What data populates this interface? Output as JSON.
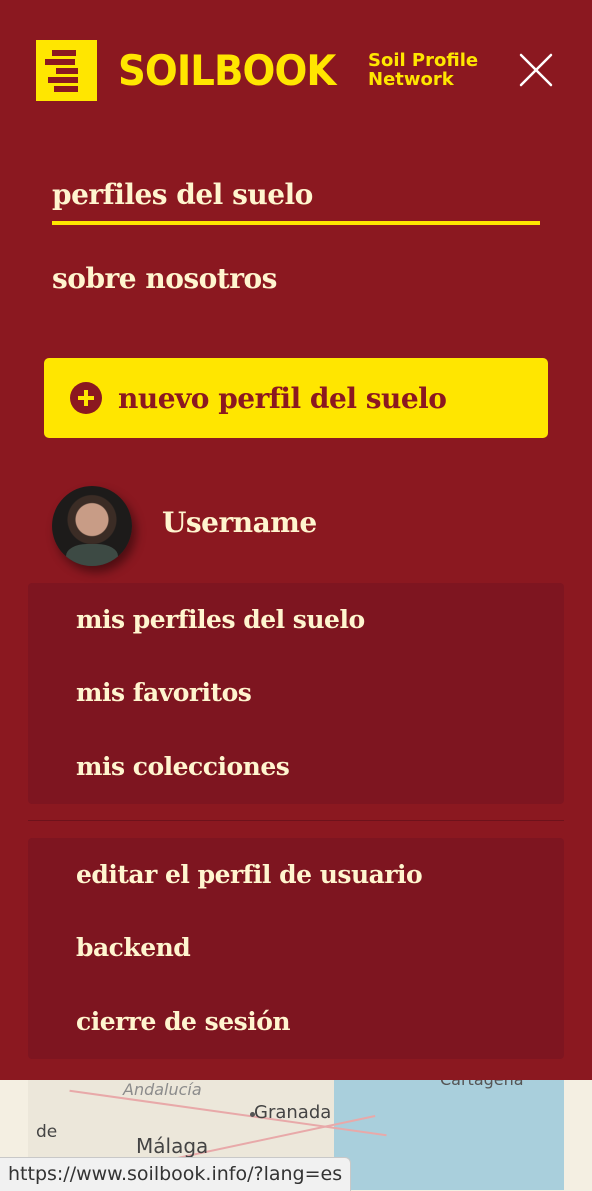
{
  "brand": {
    "name": "SOILBOOK",
    "tagline_line1": "Soil Profile",
    "tagline_line2": "Network",
    "color": "#ffe600"
  },
  "menu": {
    "background": "#8b1820",
    "nav": {
      "active": "perfiles del suelo",
      "about": "sobre nosotros"
    },
    "new_profile_button": "nuevo perfil del suelo",
    "user": {
      "name": "Username"
    },
    "user_links": [
      "mis perfiles del suelo",
      "mis favoritos",
      "mis colecciones"
    ],
    "account_links": [
      "editar el perfil de usuario",
      "backend",
      "cierre de sesión"
    ]
  },
  "map": {
    "labels": {
      "andalucia": "Andalucía",
      "granada": "Granada",
      "malaga": "Málaga",
      "de": "de",
      "cartagena": "Cartagena"
    }
  },
  "statusbar": {
    "url": "https://www.soilbook.info/?lang=es"
  }
}
